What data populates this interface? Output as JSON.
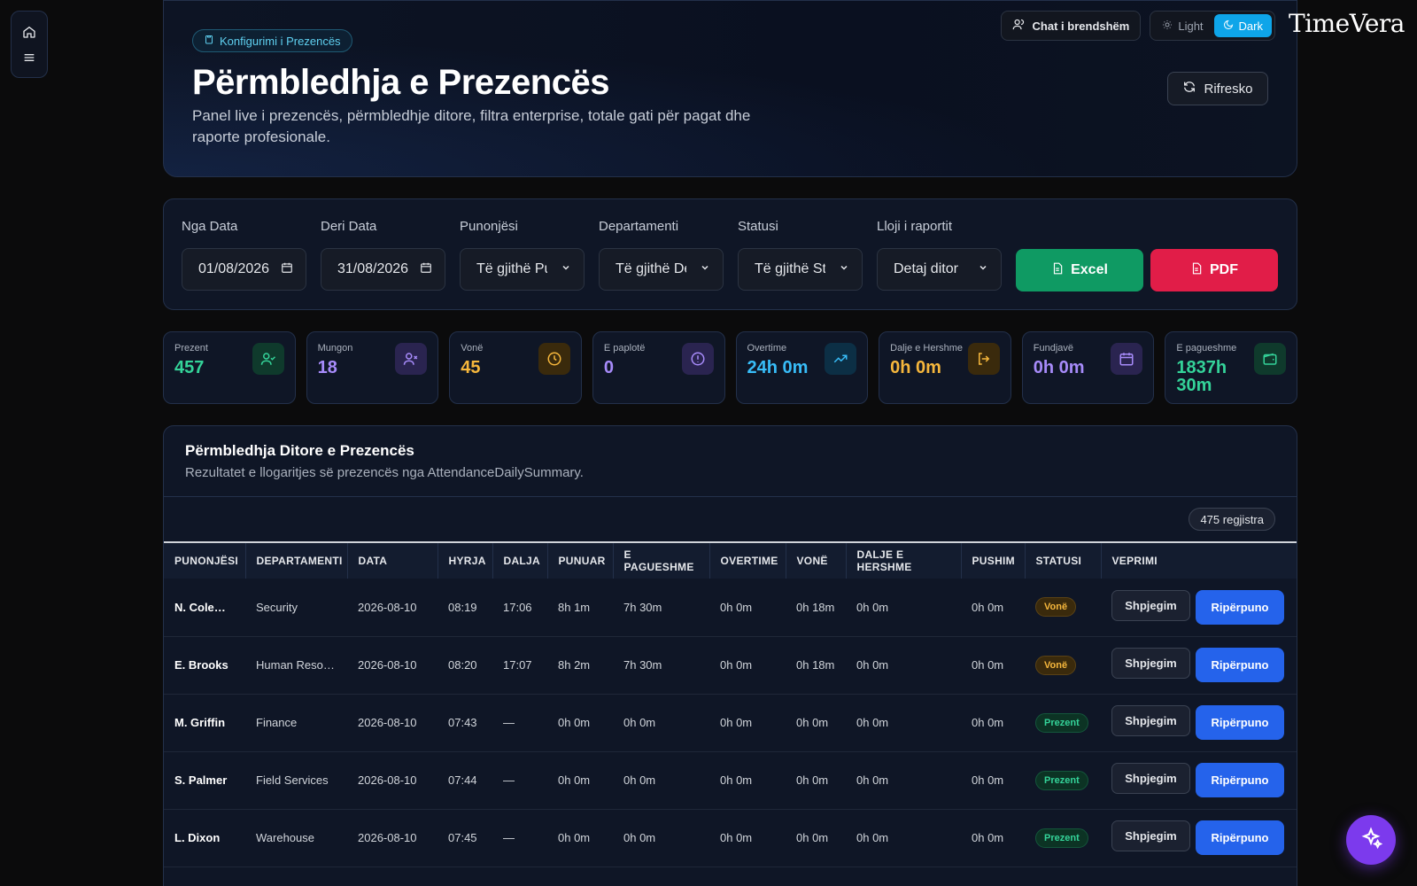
{
  "header": {
    "breadcrumb": "Konfigurimi i Prezencës",
    "title": "Përmbledhja e Prezencës",
    "description": "Panel live i prezencës, përmbledhje ditore, filtra enterprise, totale gati për pagat dhe raporte profesionale.",
    "refresh_label": "Rifresko",
    "chat_label": "Chat i brendshëm",
    "theme_light": "Light",
    "theme_dark": "Dark",
    "theme_active": "Dark",
    "logo": "TimeVera"
  },
  "filters": {
    "from_label": "Nga Data",
    "from_value": "01/08/2026",
    "to_label": "Deri Data",
    "to_value": "31/08/2026",
    "employee_label": "Punonjësi",
    "employee_value": "Të gjithë Punonjësit",
    "department_label": "Departamenti",
    "department_value": "Të gjithë Departamentet",
    "status_label": "Statusi",
    "status_value": "Të gjithë Statuset",
    "report_label": "Lloji i raportit",
    "report_value": "Detaj ditor",
    "excel_label": "Excel",
    "pdf_label": "PDF"
  },
  "stats": [
    {
      "label": "Prezent",
      "value": "457",
      "color": "#34d399",
      "icon": "user-check-icon"
    },
    {
      "label": "Mungon",
      "value": "18",
      "color": "#a78bfa",
      "icon": "user-x-icon"
    },
    {
      "label": "Vonë",
      "value": "45",
      "color": "#f6b73c",
      "icon": "clock-icon"
    },
    {
      "label": "E paplotë",
      "value": "0",
      "color": "#a78bfa",
      "icon": "alert-circle-icon"
    },
    {
      "label": "Overtime",
      "value": "24h 0m",
      "color": "#38bdf8",
      "icon": "trending-up-icon"
    },
    {
      "label": "Dalje e Hershme",
      "value": "0h 0m",
      "color": "#f6b73c",
      "icon": "log-out-icon"
    },
    {
      "label": "Fundjavë",
      "value": "0h 0m",
      "color": "#a78bfa",
      "icon": "calendar-icon"
    },
    {
      "label": "E pagueshme",
      "value": "1837h 30m",
      "color": "#34d399",
      "icon": "wallet-icon"
    }
  ],
  "table": {
    "title": "Përmbledhja Ditore e Prezencës",
    "subtitle": "Rezultatet e llogaritjes së prezencës nga AttendanceDailySummary.",
    "count": "475 regjistra",
    "columns": [
      "PUNONJËSI",
      "DEPARTAMENTI",
      "DATA",
      "HYRJA",
      "DALJA",
      "PUNUAR",
      "E PAGUESHME",
      "OVERTIME",
      "VONË",
      "DALJE E HERSHME",
      "PUSHIM",
      "STATUSI",
      "VEPRIMI"
    ],
    "explain_label": "Shpjegim",
    "redo_label": "Ripërpuno",
    "rows": [
      {
        "name": "N. Coleman",
        "dept": "Security",
        "date": "2026-08-10",
        "in": "08:19",
        "out": "17:06",
        "worked": "8h 1m",
        "payable": "7h 30m",
        "overtime": "0h 0m",
        "late": "0h 18m",
        "early": "0h 0m",
        "break": "0h 0m",
        "status": "Vonë",
        "status_type": "late"
      },
      {
        "name": "E. Brooks",
        "dept": "Human Resources",
        "date": "2026-08-10",
        "in": "08:20",
        "out": "17:07",
        "worked": "8h 2m",
        "payable": "7h 30m",
        "overtime": "0h 0m",
        "late": "0h 18m",
        "early": "0h 0m",
        "break": "0h 0m",
        "status": "Vonë",
        "status_type": "late"
      },
      {
        "name": "M. Griffin",
        "dept": "Finance",
        "date": "2026-08-10",
        "in": "07:43",
        "out": "—",
        "worked": "0h 0m",
        "payable": "0h 0m",
        "overtime": "0h 0m",
        "late": "0h 0m",
        "early": "0h 0m",
        "break": "0h 0m",
        "status": "Prezent",
        "status_type": "present"
      },
      {
        "name": "S. Palmer",
        "dept": "Field Services",
        "date": "2026-08-10",
        "in": "07:44",
        "out": "—",
        "worked": "0h 0m",
        "payable": "0h 0m",
        "overtime": "0h 0m",
        "late": "0h 0m",
        "early": "0h 0m",
        "break": "0h 0m",
        "status": "Prezent",
        "status_type": "present"
      },
      {
        "name": "L. Dixon",
        "dept": "Warehouse",
        "date": "2026-08-10",
        "in": "07:45",
        "out": "—",
        "worked": "0h 0m",
        "payable": "0h 0m",
        "overtime": "0h 0m",
        "late": "0h 0m",
        "early": "0h 0m",
        "break": "0h 0m",
        "status": "Prezent",
        "status_type": "present"
      }
    ]
  }
}
